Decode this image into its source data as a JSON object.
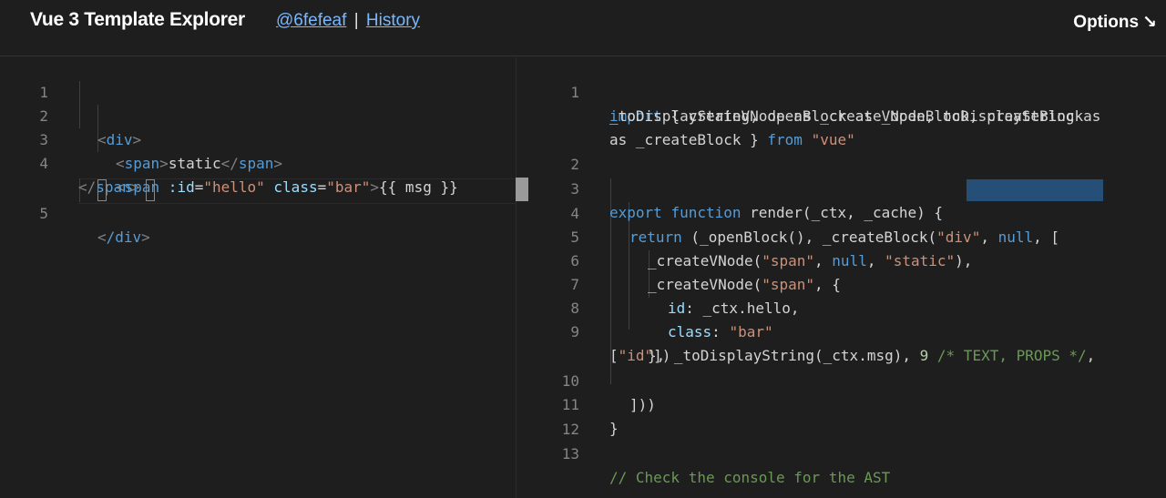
{
  "header": {
    "title": "Vue 3 Template Explorer",
    "commit_link": "@6fefeaf",
    "separator": "|",
    "history_link": "History",
    "options_label": "Options",
    "options_arrow": "↘"
  },
  "left_editor": {
    "line_numbers": [
      "1",
      "2",
      "3",
      "4",
      "5"
    ],
    "lines": {
      "l2": {
        "open": "<",
        "tag": "div",
        "close": ">"
      },
      "l3": {
        "open": "<",
        "tag": "span",
        "close": ">",
        "text": "static",
        "end_open": "</",
        "end_tag": "span",
        "end_close": ">"
      },
      "l4": {
        "open": "<",
        "tag": "span",
        "attr1": " :id",
        "eq1": "=",
        "val1": "\"hello\"",
        "attr2": " class",
        "eq2": "=",
        "val2": "\"bar\"",
        "close": ">",
        "text": "{{ msg }}"
      },
      "l4_wrap": {
        "end_open": "</",
        "end_tag": "span",
        "end_close": ">"
      },
      "l5": {
        "open": "<",
        "rest": "/div",
        "close": ">"
      }
    }
  },
  "right_editor": {
    "line_numbers": [
      "1",
      "2",
      "3",
      "4",
      "5",
      "6",
      "7",
      "8",
      "9",
      "10",
      "11",
      "12",
      "13"
    ],
    "code": {
      "r1a_kw": "import",
      "r1a_rest": " { createVNode as _createVNode, toDisplayString as",
      "r1b": "_toDisplayString, openBlock as _openBlock, createBlock",
      "r1c_a": "as _createBlock } ",
      "r1c_kw": "from",
      "r1c_sp": " ",
      "r1c_str": "\"vue\"",
      "r3_kw1": "export",
      "r3_sp": " ",
      "r3_kw2": "function",
      "r3_rest": " render(_ctx, _cache) {",
      "r4_kw": "return",
      "r4_a": " (_openBlock(), _createBlock(",
      "r4_str": "\"div\"",
      "r4_comma": ", ",
      "r4_null": "null",
      "r4_end": ", [",
      "r5_a": "_createVNode(",
      "r5_s1": "\"span\"",
      "r5_b": ", ",
      "r5_null": "null",
      "r5_c": ", ",
      "r5_s2": "\"static\"",
      "r5_d": "),",
      "r6_a": "_createVNode(",
      "r6_s1": "\"span\"",
      "r6_b": ", {",
      "r7_prop": "id",
      "r7_rest": ": _ctx.hello,",
      "r8_prop": "class",
      "r8_colon": ": ",
      "r8_str": "\"bar\"",
      "r9_a": "}, _toDisplayString(_ctx.msg), ",
      "r9_num": "9",
      "r9_sp": " ",
      "r9_comment": "/* TEXT, PROPS */",
      "r9_end": ",",
      "r9b_a": "[",
      "r9b_str": "\"id\"",
      "r9b_b": "])",
      "r10": "]))",
      "r11": "}",
      "r13": "// Check the console for the AST"
    }
  }
}
